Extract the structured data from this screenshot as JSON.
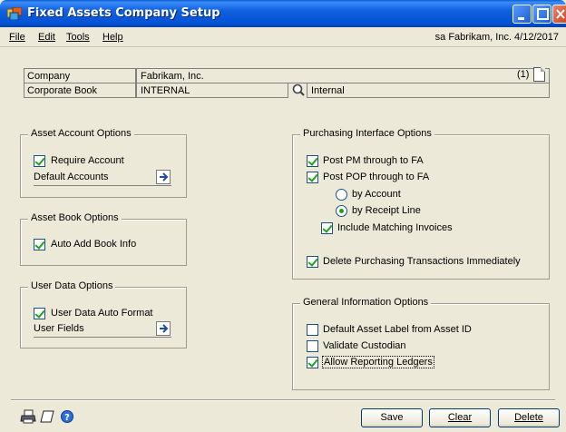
{
  "window": {
    "title": "Fixed Assets Company Setup"
  },
  "menu": {
    "file": "File",
    "edit": "Edit",
    "tools": "Tools",
    "help": "Help",
    "user_info": "sa  Fabrikam, Inc.  4/12/2017"
  },
  "fields": {
    "company_label": "Company",
    "company_value": "Fabrikam, Inc.",
    "company_count": "(1)",
    "book_label": "Corporate Book",
    "book_value": "INTERNAL",
    "book_desc": "Internal"
  },
  "asset_account": {
    "title": "Asset Account Options",
    "require_account": "Require Account",
    "require_account_checked": true,
    "default_accounts": "Default Accounts"
  },
  "asset_book": {
    "title": "Asset Book Options",
    "auto_add": "Auto Add Book Info",
    "auto_add_checked": true
  },
  "user_data": {
    "title": "User Data Options",
    "auto_format": "User Data Auto Format",
    "auto_format_checked": true,
    "user_fields": "User Fields"
  },
  "purchasing": {
    "title": "Purchasing Interface Options",
    "post_pm": "Post PM through to FA",
    "post_pm_checked": true,
    "post_pop": "Post POP through to FA",
    "post_pop_checked": true,
    "by_account": "by Account",
    "by_receipt_line": "by Receipt Line",
    "selected_radio": "by Receipt Line",
    "include_matching": "Include Matching Invoices",
    "include_matching_checked": true,
    "delete_purchasing": "Delete Purchasing Transactions Immediately",
    "delete_purchasing_checked": true
  },
  "general": {
    "title": "General Information Options",
    "default_label": "Default Asset Label from Asset ID",
    "default_label_checked": false,
    "validate_custodian": "Validate Custodian",
    "validate_custodian_checked": false,
    "allow_reporting": "Allow Reporting Ledgers",
    "allow_reporting_checked": true
  },
  "buttons": {
    "save": "Save",
    "clear": "Clear",
    "delete": "Delete"
  },
  "icons": [
    "printer-icon",
    "note-icon",
    "help-icon",
    "lookup-icon",
    "arrow-right-icon"
  ]
}
